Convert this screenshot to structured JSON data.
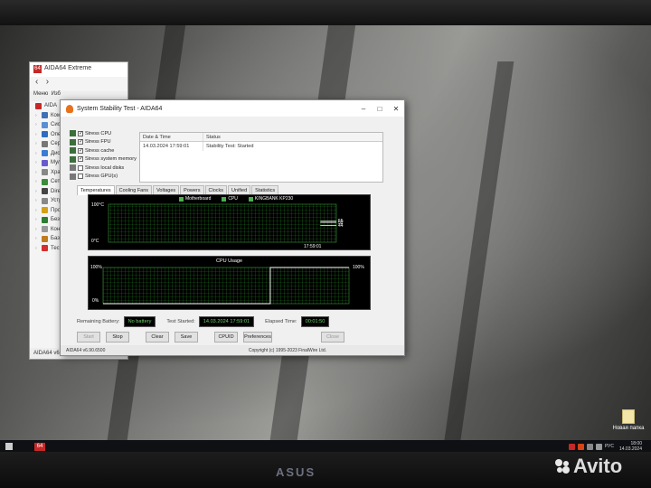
{
  "main_window": {
    "title": "AIDA64 Extreme",
    "menu": "Меню",
    "menu2": "Изб",
    "nav_prev": "‹",
    "nav_next": "›",
    "root": "AIDA",
    "items": [
      {
        "label": "Комп",
        "color": "#3f6fb5"
      },
      {
        "label": "Сист",
        "color": "#5a8fd4"
      },
      {
        "label": "Опер",
        "color": "#2d6cc0"
      },
      {
        "label": "Серв",
        "color": "#777"
      },
      {
        "label": "Диспл",
        "color": "#3a7cd4"
      },
      {
        "label": "Мульт",
        "color": "#6a5acd"
      },
      {
        "label": "Хран",
        "color": "#888"
      },
      {
        "label": "Сеть",
        "color": "#3a8d3a"
      },
      {
        "label": "Direc",
        "color": "#444"
      },
      {
        "label": "Устр",
        "color": "#888"
      },
      {
        "label": "Прог",
        "color": "#d4a017"
      },
      {
        "label": "Безоп",
        "color": "#2e7d32"
      },
      {
        "label": "Конф",
        "color": "#999"
      },
      {
        "label": "База",
        "color": "#c27c1e"
      },
      {
        "label": "Тест",
        "color": "#d32f2f"
      }
    ],
    "status": "AIDA64 v6.90.6500"
  },
  "stability": {
    "title": "System Stability Test - AIDA64",
    "options": [
      {
        "label": "Stress CPU",
        "checked": true
      },
      {
        "label": "Stress FPU",
        "checked": true
      },
      {
        "label": "Stress cache",
        "checked": true
      },
      {
        "label": "Stress system memory",
        "checked": true
      },
      {
        "label": "Stress local disks",
        "checked": false
      },
      {
        "label": "Stress GPU(s)",
        "checked": false
      }
    ],
    "table": {
      "col1": "Date & Time",
      "col2": "Status",
      "row_date": "14.03.2024 17:59:01",
      "row_status": "Stability Test: Started"
    },
    "tabs": [
      "Temperatures",
      "Cooling Fans",
      "Voltages",
      "Powers",
      "Clocks",
      "Unified",
      "Statistics"
    ],
    "temp_graph": {
      "legend": [
        "Motherboard",
        "CPU",
        "KINGBANK KP230"
      ],
      "y_top": "100°C",
      "y_bottom": "0°C",
      "time": "17:59:01",
      "values": [
        "55",
        "52",
        "44"
      ],
      "value_levels": [
        55,
        52,
        44
      ],
      "line_color": "#ffffff"
    },
    "cpu_graph": {
      "title": "CPU Usage",
      "y_top_left": "100%",
      "y_bottom_left": "0%",
      "y_top_right": "100%",
      "jump_fraction": 0.68,
      "line_color": "#ffffff"
    },
    "remaining_battery_label": "Remaining Battery:",
    "remaining_battery": "No battery",
    "test_started_label": "Test Started:",
    "test_started": "14.03.2024 17:59:01",
    "elapsed_label": "Elapsed Time:",
    "elapsed": "00:01:50",
    "buttons": {
      "start": "Start",
      "stop": "Stop",
      "clear": "Clear",
      "save": "Save",
      "cpuid": "CPUID",
      "preferences": "Preferences",
      "close": "Close"
    },
    "footer_left": "AIDA64 v6.90.6500",
    "footer_right": "Copyright (c) 1995-2023 FinalWire Ltd."
  },
  "taskbar": {
    "app": "64",
    "lang": "РУС",
    "time": "18:00",
    "date": "14.03.2024"
  },
  "desktop": {
    "icon_label": "Новая папка"
  },
  "bezel": {
    "brand": "ASUS",
    "watermark": "Avito"
  }
}
